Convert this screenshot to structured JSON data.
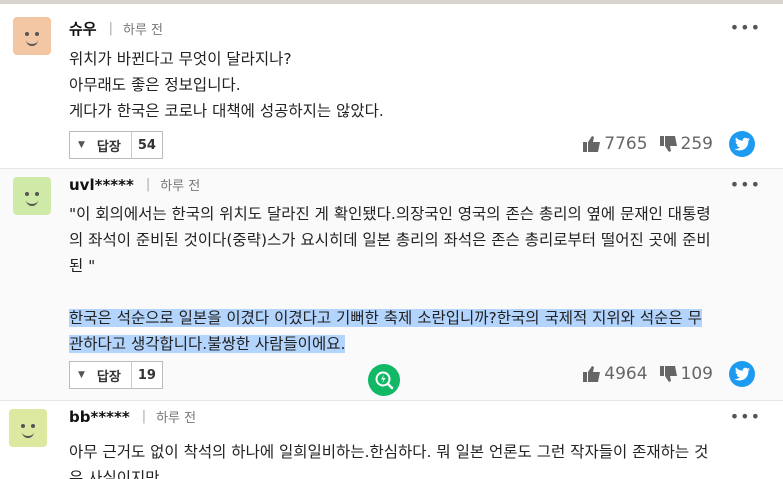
{
  "common": {
    "time": "하루 전",
    "reply_label": "답장",
    "more": "•••"
  },
  "comments": [
    {
      "user": "슈우",
      "avatar_color": "#f3c7a3",
      "lines": [
        "위치가 바뀐다고 무엇이 달라지나?",
        "아무래도 좋은 정보입니다.",
        "게다가 한국은 코로나 대책에 성공하지는 않았다."
      ],
      "reply_count": "54",
      "likes": "7765",
      "dislikes": "259"
    },
    {
      "user": "uvl*****",
      "avatar_color": "#cfe9a6",
      "lines": [
        "\"이 회의에서는 한국의 위치도 달라진 게 확인됐다.의장국인 영국의 존슨 총리의 옆에 문재인 대통령",
        "의 좌석이 준비된 것이다(중략)스가 요시히데 일본 총리의 좌석은 존슨 총리로부터 떨어진 곳에 준비",
        "된 \""
      ],
      "highlighted": [
        "한국은 석순으로 일본을 이겼다 이겼다고 기뻐한 축제 소란입니까?한국의 국제적 지위와 석순은 무",
        "관하다고 생각합니다.불쌍한 사람들이에요."
      ],
      "reply_count": "19",
      "likes": "4964",
      "dislikes": "109"
    },
    {
      "user": "bb*****",
      "avatar_color": "#dde8a0",
      "lines": [
        "아무 근거도 없이 착석의 하나에 일희일비하는.한심하다. 뭐 일본 언론도 그런 작자들이 존재하는 것",
        "은 사실이지만"
      ]
    }
  ],
  "colors": {
    "highlight": "#b3d4fd",
    "twitter": "#1d9bf0",
    "badge": "#11b865"
  }
}
